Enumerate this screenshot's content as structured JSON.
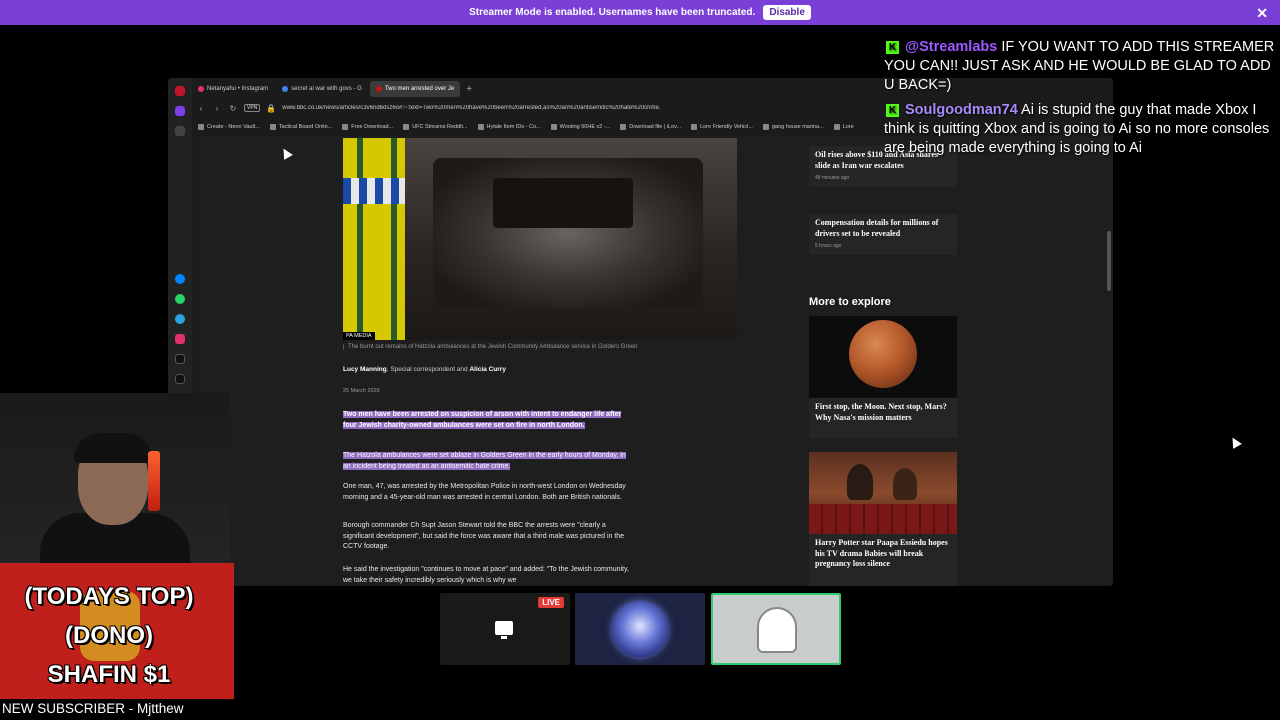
{
  "banner": {
    "text": "Streamer Mode is enabled. Usernames have been truncated.",
    "button": "Disable",
    "close": "✕"
  },
  "browser": {
    "tabs": [
      {
        "label": "Netanyahu • Instagram",
        "color": "#e1306c"
      },
      {
        "label": "secret ai war with govs - G",
        "color": "#4285f4"
      },
      {
        "label": "Two men arrested over Je",
        "color": "#bb1919"
      }
    ],
    "vpn": "VPN",
    "url": "www.bbc.co.uk/news/articles/c3v6nd6dsz6o#:~:text=Two%20men%20have%20been%20arrested,as%20an%20antisemitic%20hate%20crime.",
    "bookmarks": [
      "Create - Neon Vault...",
      "Tactical Board Onlin...",
      "Free Download...",
      "UFC Streams Reddit...",
      "Hytale Item IDs - Co...",
      "Wooting 60HE v2 -...",
      "Download file | iLov...",
      "Lore Friendly Vehicl...",
      "gang house marina...",
      "Lore"
    ]
  },
  "article": {
    "image_credit": "PA MEDIA",
    "caption": "The burnt out remains of Hatzola ambulances at the Jewish Community Ambulance service in Golders Green",
    "author1": "Lucy Manning",
    "role": ", Special correspondent and ",
    "author2": "Alicia Curry",
    "date": "25 March 2026",
    "p1": "Two men have been arrested on suspicion of arson with intent to endanger life after four Jewish charity-owned ambulances were set on fire in north London.",
    "p2": "The Hatzola ambulances were set ablaze in Golders Green in the early hours of Monday, in an incident being treated as an antisemitic hate crime.",
    "p3": "One man, 47, was arrested by the Metropolitan Police in north-west London on Wednesday morning and a 45-year-old man was arrested in central London. Both are British nationals.",
    "p4": "Borough commander Ch Supt Jason Stewart told the BBC the arrests were \"clearly a significant development\", but said the force was aware that a third male was pictured in the CCTV footage.",
    "p5": "He said the investigation \"continues to move at pace\" and added: \"To the Jewish community, we take their safety incredibly seriously which is why we"
  },
  "sidebar": {
    "card1_title": "Oil rises above $110 and Asia shares slide as Iran war escalates",
    "card1_time": "48 minutes ago",
    "card2_title": "Compensation details for millions of drivers set to be revealed",
    "card2_time": "5 hours ago",
    "explore_heading": "More to explore",
    "explore1": "First stop, the Moon. Next stop, Mars? Why Nasa's mission matters",
    "explore2": "Harry Potter star Paapa Essiedu hopes his TV drama Babies will break pregnancy loss silence"
  },
  "chat": [
    {
      "user": "@Streamlabs",
      "text": "IF YOU WANT TO ADD THIS STREAMER YOU CAN!! JUST ASK AND HE WOULD BE GLAD TO ADD U BACK=)"
    },
    {
      "user": "Soulgoodman74",
      "text": "Ai is stupid the guy that made Xbox I think is quitting Xbox and is going to Ai so no more consoles are being made everything is going to Ai"
    }
  ],
  "donation": {
    "line1": "(TODAYS TOP)",
    "line2": "(DONO)",
    "line3": "SHAFIN $1"
  },
  "new_subscriber": "NEW SUBSCRIBER - Mjtthew",
  "thumbnails": {
    "live_badge": "LIVE"
  }
}
